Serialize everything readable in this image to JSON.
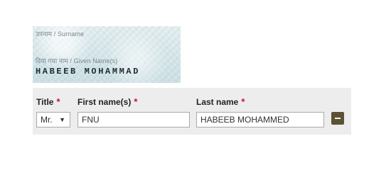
{
  "id_document": {
    "surname_label": "उपनाम / Surname",
    "given_name_label": "दिया गया नाम / Given Name(s)",
    "given_name_value": "HABEEB MOHAMMAD"
  },
  "form": {
    "title_label": "Title",
    "first_name_label": "First name(s)",
    "last_name_label": "Last name",
    "required_marker": "*",
    "title_selected": "Mr.",
    "first_name_value": "FNU",
    "last_name_value": "HABEEB MOHAMMED",
    "accent_color": "#c0162b",
    "remove_button_color": "#5a5232"
  }
}
